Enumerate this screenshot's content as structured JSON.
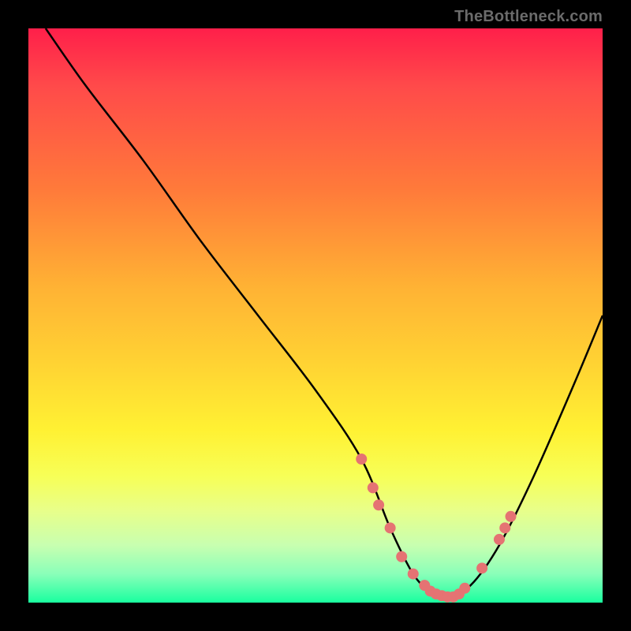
{
  "watermark": "TheBottleneck.com",
  "chart_data": {
    "type": "line",
    "title": "",
    "xlabel": "",
    "ylabel": "",
    "xlim": [
      0,
      100
    ],
    "ylim": [
      0,
      100
    ],
    "grid": false,
    "legend": false,
    "series": [
      {
        "name": "curve",
        "x": [
          3,
          10,
          20,
          30,
          40,
          50,
          58,
          63,
          67,
          70,
          73,
          77,
          82,
          88,
          95,
          100
        ],
        "y": [
          100,
          90,
          77,
          63,
          50,
          37,
          25,
          13,
          5,
          2,
          1,
          3,
          10,
          22,
          38,
          50
        ]
      }
    ],
    "markers": [
      {
        "x": 58,
        "y": 25
      },
      {
        "x": 60,
        "y": 20
      },
      {
        "x": 61,
        "y": 17
      },
      {
        "x": 63,
        "y": 13
      },
      {
        "x": 65,
        "y": 8
      },
      {
        "x": 67,
        "y": 5
      },
      {
        "x": 69,
        "y": 3
      },
      {
        "x": 70,
        "y": 2
      },
      {
        "x": 71,
        "y": 1.5
      },
      {
        "x": 72,
        "y": 1.2
      },
      {
        "x": 73,
        "y": 1
      },
      {
        "x": 74,
        "y": 1
      },
      {
        "x": 75,
        "y": 1.5
      },
      {
        "x": 76,
        "y": 2.5
      },
      {
        "x": 79,
        "y": 6
      },
      {
        "x": 82,
        "y": 11
      },
      {
        "x": 83,
        "y": 13
      },
      {
        "x": 84,
        "y": 15
      }
    ],
    "marker_color": "#e57373"
  }
}
